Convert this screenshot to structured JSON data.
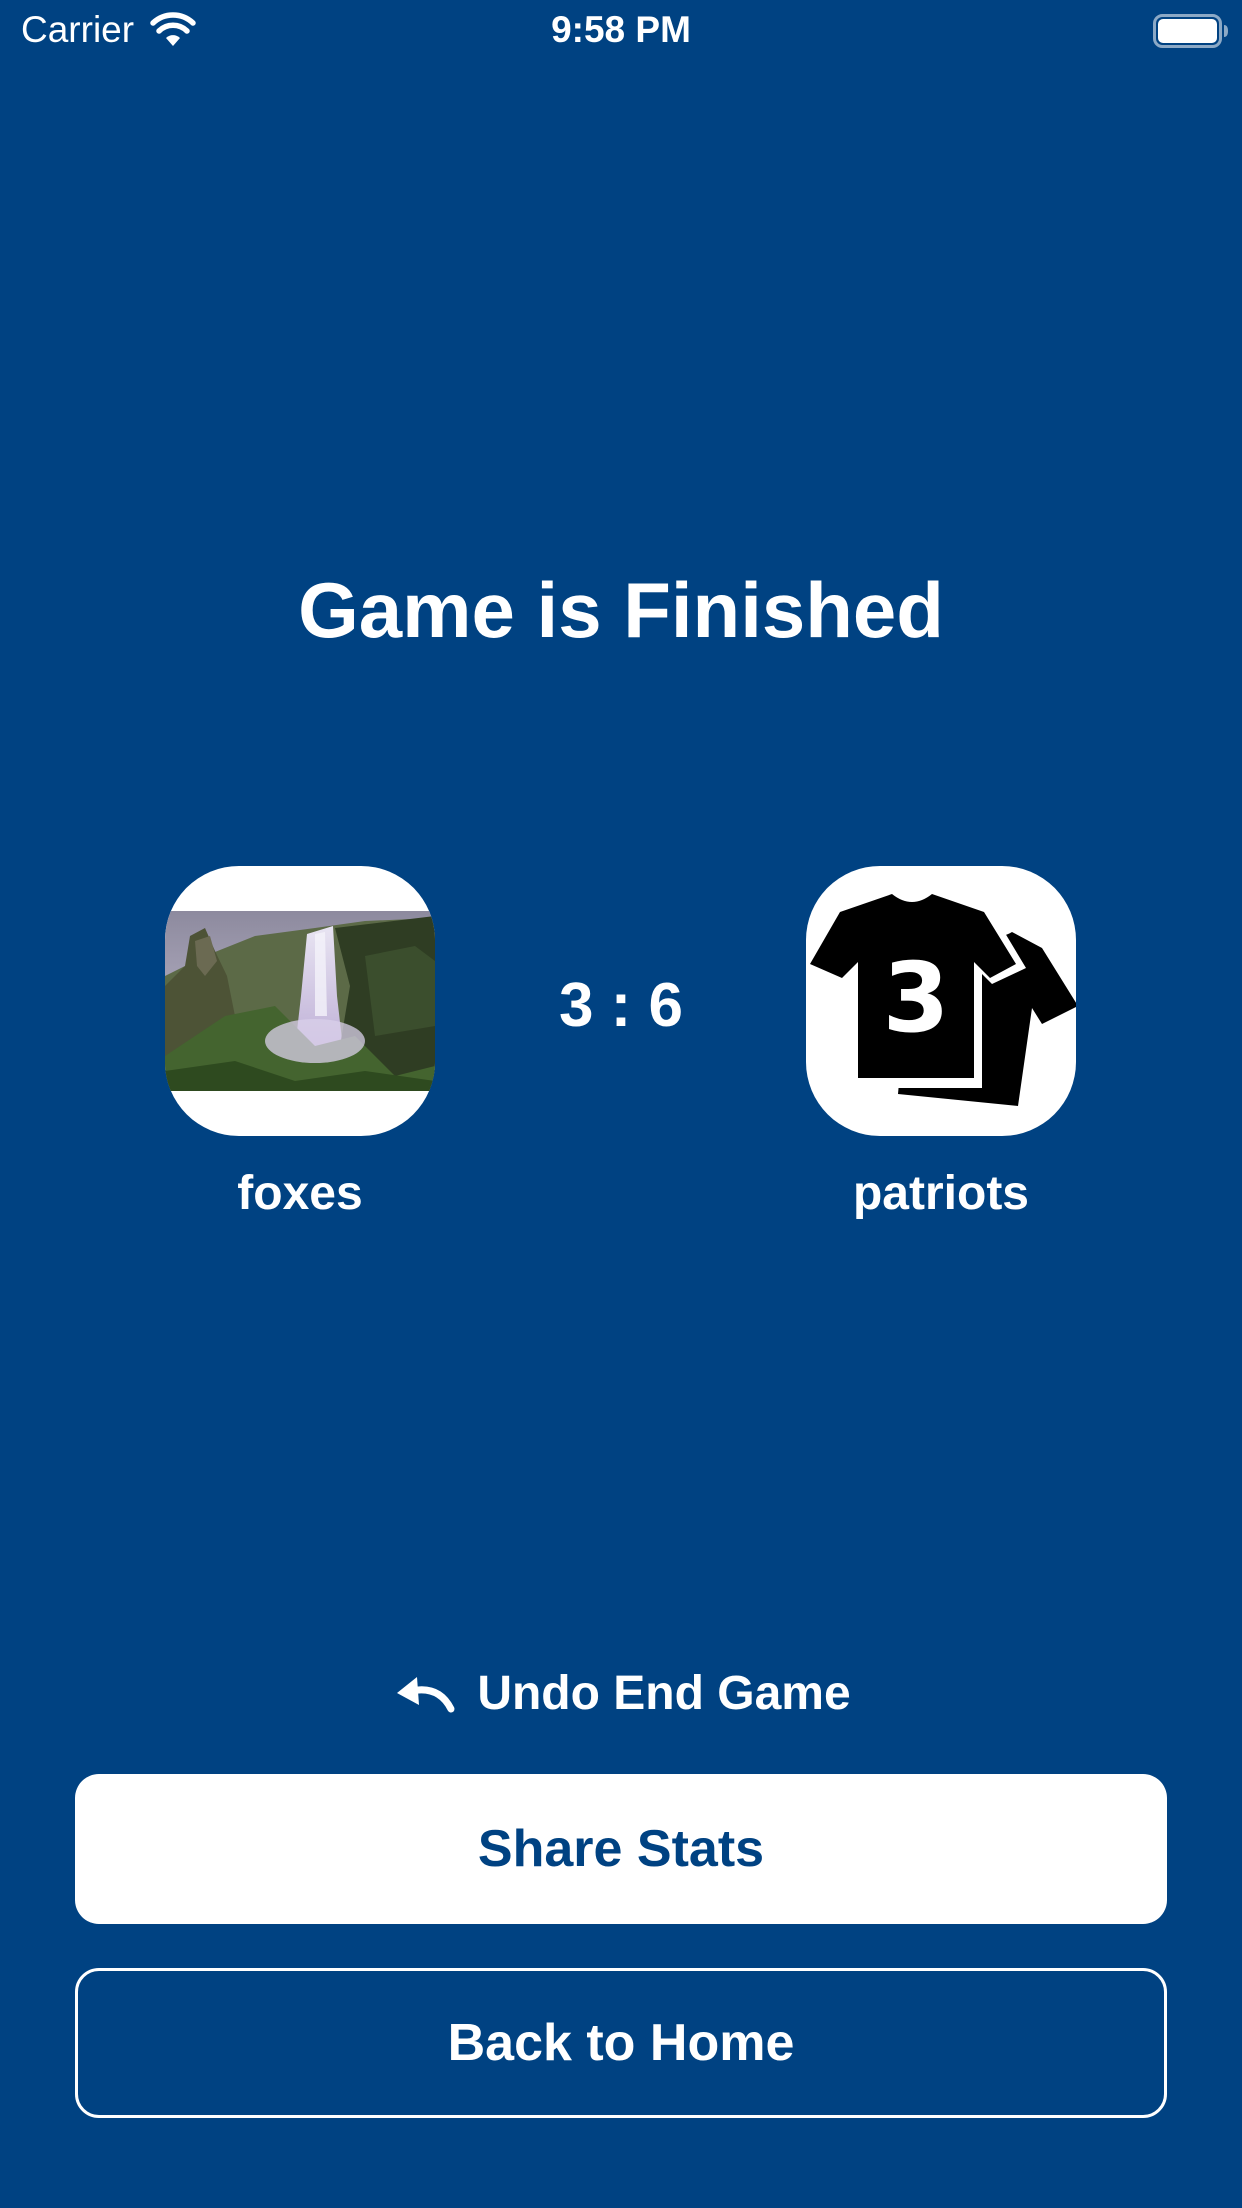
{
  "status_bar": {
    "carrier": "Carrier",
    "time": "9:58 PM",
    "wifi_icon": "wifi-icon",
    "battery_icon": "battery-full-icon"
  },
  "title": "Game is Finished",
  "home_team": {
    "name": "foxes",
    "logo": "waterfall-photo"
  },
  "away_team": {
    "name": "patriots",
    "logo": "jersey-number-3-icon"
  },
  "score": "3 : 6",
  "undo": {
    "icon": "undo-arrow-icon",
    "label": "Undo End Game"
  },
  "buttons": {
    "share_label": "Share Stats",
    "home_label": "Back to Home"
  },
  "jersey_number": "3",
  "colors": {
    "background": "#004282",
    "foreground": "#ffffff"
  }
}
